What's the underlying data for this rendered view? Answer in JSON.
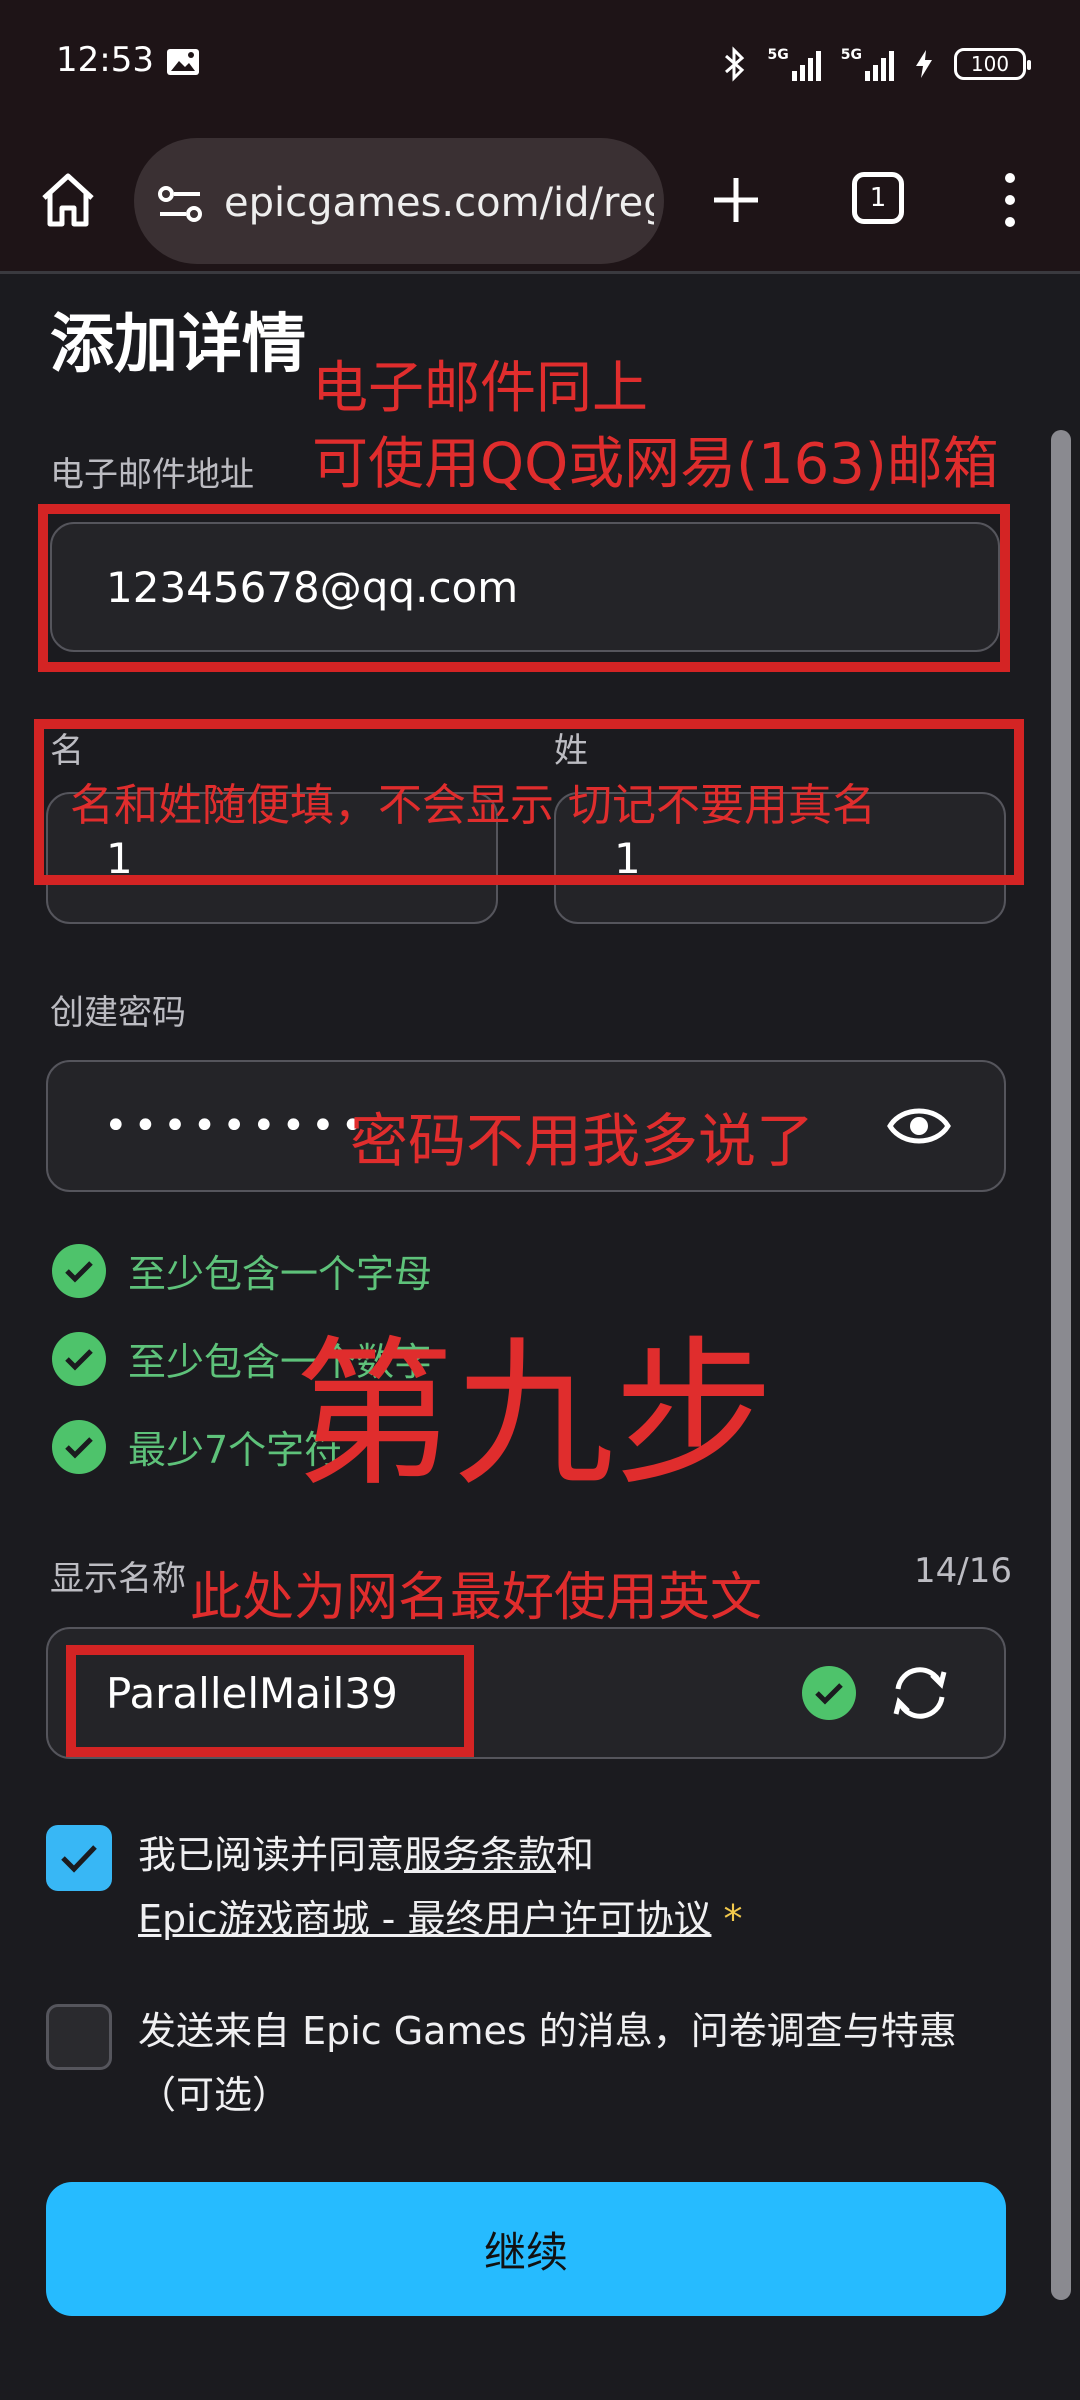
{
  "status": {
    "time": "12:53",
    "net1": "5G",
    "net2": "5G",
    "battery": "100"
  },
  "browser": {
    "url": "epicgames.com/id/reg",
    "tab_count": "1"
  },
  "form": {
    "title": "添加详情",
    "email_label": "电子邮件地址",
    "email_value": "12345678@qq.com",
    "first_name_label": "名",
    "first_name_value": "1",
    "last_name_label": "姓",
    "last_name_value": "1",
    "password_label": "创建密码",
    "password_value": "•••••••••",
    "requirements": [
      "至少包含一个字母",
      "至少包含一个数字",
      "最少7个字符"
    ],
    "display_name_label": "显示名称",
    "display_name_counter": "14/16",
    "display_name_value": "ParallelMail39",
    "agree_prefix": "我已阅读并同意",
    "terms_link": "服务条款",
    "agree_and": "和",
    "eula_link": "Epic游戏商城 - 最终用户许可协议",
    "asterisk": "*",
    "marketing_line1": "发送来自 Epic Games 的消息，问卷调查与特惠",
    "marketing_line2": "（可选）",
    "continue_label": "继续"
  },
  "annotations": {
    "email_line1": "电子邮件同上",
    "email_line2": "可使用QQ或网易(163)邮箱",
    "name": "名和姓随便填，不会显示 切记不要用真名",
    "password": "密码不用我多说了",
    "step": "第九步",
    "display_name": "此处为网名最好使用英文"
  },
  "colors": {
    "accent": "#26bbff",
    "annotation": "#d42424",
    "success": "#4ec36b"
  }
}
